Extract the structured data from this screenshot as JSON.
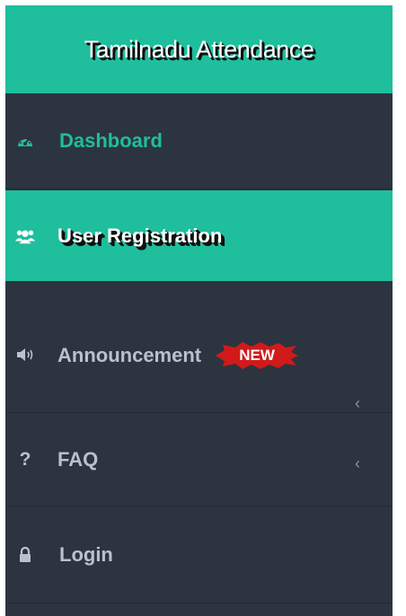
{
  "app": {
    "title": "Tamilnadu Attendance"
  },
  "menu": {
    "items": [
      {
        "label": "Dashboard",
        "icon": "dashboard-gauge-icon"
      },
      {
        "label": "User Registration",
        "icon": "users-icon"
      },
      {
        "label": "Announcement",
        "icon": "speaker-icon",
        "badge": "NEW",
        "chevron": "‹"
      },
      {
        "label": "FAQ",
        "icon": "question-icon",
        "chevron": "‹"
      },
      {
        "label": "Login",
        "icon": "lock-icon"
      }
    ]
  },
  "colors": {
    "accent": "#1fbe9c",
    "sidebar": "#2c3440",
    "badge": "#d11a1a",
    "muted_text": "#b9c2cc"
  }
}
